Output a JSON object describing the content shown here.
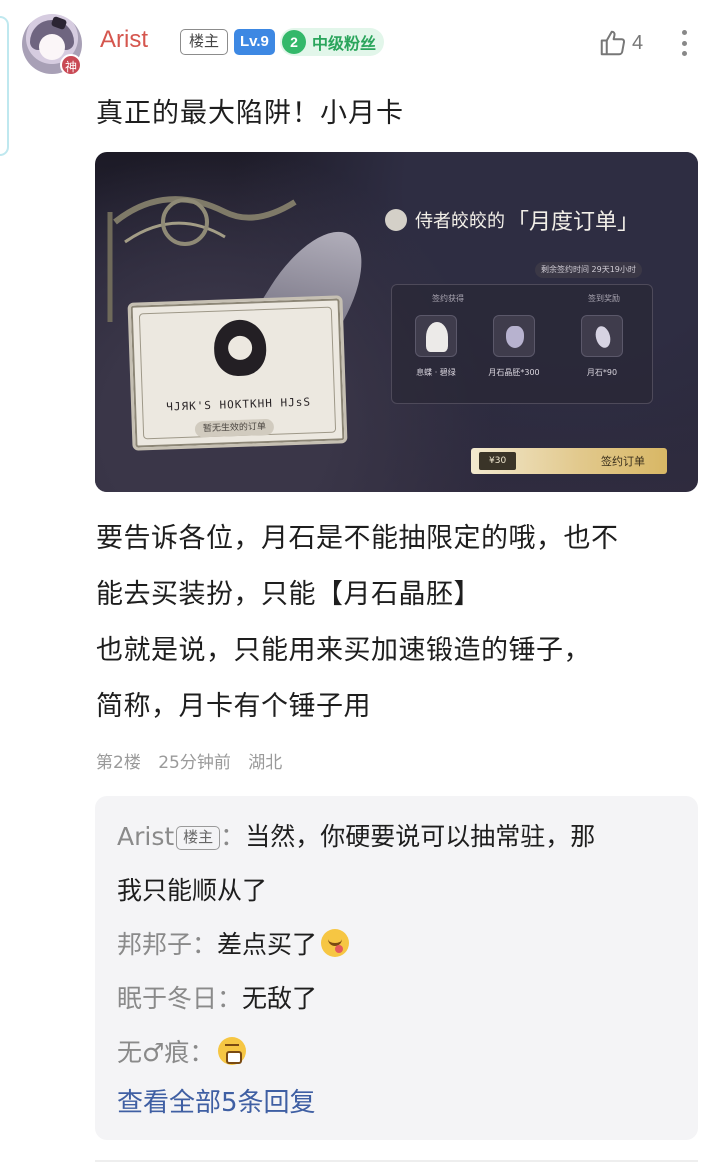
{
  "post": {
    "author": {
      "name": "Arist",
      "avatar_badge": "神",
      "host_tag": "楼主",
      "level": "Lv.9",
      "fan_level": "2",
      "fan_label": "中级粉丝"
    },
    "like_count": "4",
    "title": "真正的最大陷阱！小月卡",
    "image": {
      "title_prefix": "侍者皎皎的",
      "title_main": "「月度订单」",
      "timer": "剩余签约时间 29天19小时",
      "card_runes": "ЧJЯК'Ѕ НОКТКНН НЈѕЅ",
      "card_pill": "暂无生效的订单",
      "group1_label": "签约获得",
      "group2_label": "签到奖励",
      "rewards": [
        {
          "name": "息蝶 · 碧绿",
          "icon": "character-portrait"
        },
        {
          "name": "月石晶胚*300",
          "icon": "moon-crystal"
        },
        {
          "name": "月石*90",
          "icon": "moonstone"
        }
      ],
      "price": "¥30",
      "buy_label": "签约订单"
    },
    "body_lines": [
      "要告诉各位，月石是不能抽限定的哦，也不",
      "能去买装扮，只能【月石晶胚】",
      "也就是说，只能用来买加速锻造的锤子，",
      "简称，月卡有个锤子用"
    ],
    "meta": {
      "floor": "第2楼",
      "time": "25分钟前",
      "location": "湖北"
    }
  },
  "replies": {
    "items": [
      {
        "author": "Arist",
        "tag": "楼主",
        "sep": "：",
        "text": "当然，你硬要说可以抽常驻，那",
        "text2": "我只能顺从了"
      },
      {
        "author": "邦邦子",
        "sep": "：",
        "text": "差点买了",
        "emoji": "yum-face"
      },
      {
        "author": "眠于冬日",
        "sep": "：",
        "text": "无敌了"
      },
      {
        "author": "无♂痕",
        "sep": "：",
        "text": "",
        "emoji": "gasp-face"
      }
    ],
    "view_all": "查看全部5条回复"
  }
}
